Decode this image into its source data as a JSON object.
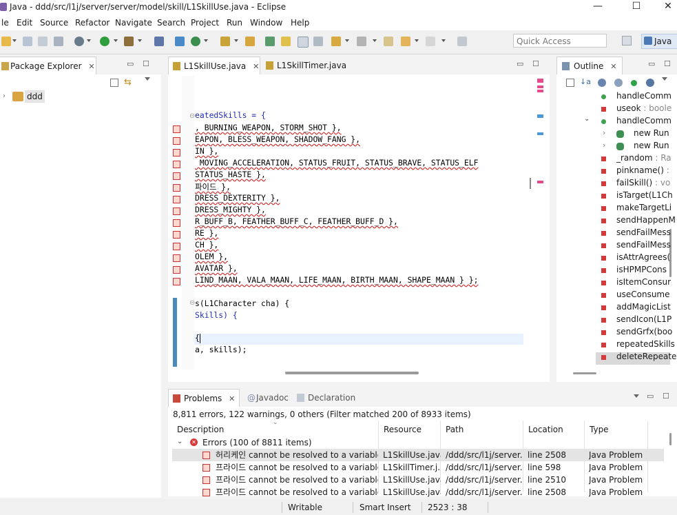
{
  "window": {
    "title": "Java - ddd/src/l1j/server/server/model/skill/L1SkillUse.java - Eclipse",
    "min": "—",
    "max": "☐",
    "close": "✕"
  },
  "menu": [
    "le",
    "Edit",
    "Source",
    "Refactor",
    "Navigate",
    "Search",
    "Project",
    "Run",
    "Window",
    "Help"
  ],
  "toolbar": {
    "quick_access_placeholder": "Quick Access",
    "perspective": "Java"
  },
  "package_explorer": {
    "tab": "Package Explorer",
    "project": "ddd"
  },
  "editor": {
    "tabs": [
      "L1SkillUse.java",
      "L1SkillTimer.java"
    ],
    "lines": [
      {
        "text": "eatedSkills = {",
        "italic": true,
        "err": false
      },
      {
        "text": ", BURNING_WEAPON, STORM_SHOT },",
        "err": true
      },
      {
        "text": "EAPON, BLESS_WEAPON, SHADOW_FANG },",
        "err": true
      },
      {
        "text": "IN },",
        "err": true
      },
      {
        "text": " MOVING_ACCELERATION, STATUS_FRUIT, STATUS_BRAVE, STATUS_ELF",
        "err": true
      },
      {
        "text": "STATUS_HASTE },",
        "err": true
      },
      {
        "text": "파이드 },",
        "err": true
      },
      {
        "text": "DRESS_DEXTERITY },",
        "err": true
      },
      {
        "text": "DRESS_MIGHTY },",
        "err": true
      },
      {
        "text": "R_BUFF_B, FEATHER_BUFF_C, FEATHER_BUFF_D },",
        "err": true
      },
      {
        "text": "RE },",
        "err": true
      },
      {
        "text": "CH },",
        "err": true
      },
      {
        "text": "OLEM },",
        "err": true
      },
      {
        "text": "AVATAR },",
        "err": true
      },
      {
        "text": "LIND_MAAN, VALA_MAAN, LIFE_MAAN, BIRTH_MAAN, SHAPE_MAAN } };",
        "err": true
      },
      {
        "text": "",
        "err": false
      },
      {
        "text": "s(L1Character cha) {",
        "err": false
      },
      {
        "text": "Skills) {",
        "err": false,
        "italic_prefix": true
      },
      {
        "text": "",
        "err": false
      },
      {
        "text": "{",
        "err": false
      },
      {
        "text": "a, skills);",
        "err": false
      }
    ]
  },
  "outline": {
    "tab": "Outline",
    "items": [
      {
        "name": "handleComm",
        "type": "",
        "kind": "public-method"
      },
      {
        "name": "useok",
        "type": " : boole",
        "kind": "private-field"
      },
      {
        "name": "handleComm",
        "type": "",
        "kind": "public-method"
      },
      {
        "name": "new Run",
        "type": "",
        "kind": "anon"
      },
      {
        "name": "new Run",
        "type": "",
        "kind": "anon"
      },
      {
        "name": "_random",
        "type": " : Ra",
        "kind": "static-field"
      },
      {
        "name": "pinkname()",
        "type": " : ",
        "kind": "private-method"
      },
      {
        "name": "failSkill()",
        "type": " : vo",
        "kind": "private-method"
      },
      {
        "name": "isTarget(L1Ch",
        "type": "",
        "kind": "private-method"
      },
      {
        "name": "makeTargetLi",
        "type": "",
        "kind": "private-method"
      },
      {
        "name": "sendHappenM",
        "type": "",
        "kind": "private-method"
      },
      {
        "name": "sendFailMess",
        "type": "",
        "kind": "private-method"
      },
      {
        "name": "sendFailMess",
        "type": "",
        "kind": "private-method"
      },
      {
        "name": "isAttrAgrees(",
        "type": "",
        "kind": "private-method"
      },
      {
        "name": "isHPMPCons",
        "type": "",
        "kind": "private-method"
      },
      {
        "name": "isItemConsur",
        "type": "",
        "kind": "private-method"
      },
      {
        "name": "useConsume",
        "type": "",
        "kind": "private-method"
      },
      {
        "name": "addMagicList",
        "type": "",
        "kind": "private-method"
      },
      {
        "name": "sendIcon(L1P",
        "type": "",
        "kind": "private-method"
      },
      {
        "name": "sendGrfx(boo",
        "type": "",
        "kind": "private-method"
      },
      {
        "name": "repeatedSkills",
        "type": "",
        "kind": "static-final-err"
      },
      {
        "name": "deleteRepeate",
        "type": "",
        "kind": "private-method"
      }
    ]
  },
  "problems": {
    "tabs": [
      "Problems",
      "Javadoc",
      "Declaration"
    ],
    "summary": "8,811 errors, 122 warnings, 0 others (Filter matched 200 of 8933 items)",
    "columns": [
      "Description",
      "Resource",
      "Path",
      "Location",
      "Type"
    ],
    "group": "Errors (100 of 8811 items)",
    "rows": [
      {
        "desc": "허리케인 cannot be resolved to a variable",
        "res": "L1SkillUse.java",
        "path": "/ddd/src/l1j/server...",
        "loc": "line 2508",
        "type": "Java Problem"
      },
      {
        "desc": "프라이드 cannot be resolved to a variable",
        "res": "L1SkillTimer.j...",
        "path": "/ddd/src/l1j/server...",
        "loc": "line 598",
        "type": "Java Problem"
      },
      {
        "desc": "프라이드 cannot be resolved to a variable",
        "res": "L1SkillUse.java",
        "path": "/ddd/src/l1j/server...",
        "loc": "line 2510",
        "type": "Java Problem"
      },
      {
        "desc": "프라이드 cannot be resolved to a variable",
        "res": "L1SkillUse.java",
        "path": "/ddd/src/l1j/server...",
        "loc": "line 2508",
        "type": "Java Problem"
      }
    ]
  },
  "status": {
    "writable": "Writable",
    "insert": "Smart Insert",
    "position": "2523 : 38"
  },
  "colors": {
    "selection": "#e4e4e4",
    "error": "#d03030",
    "method_public": "#4aa84a",
    "method_private": "#d03a3a"
  }
}
